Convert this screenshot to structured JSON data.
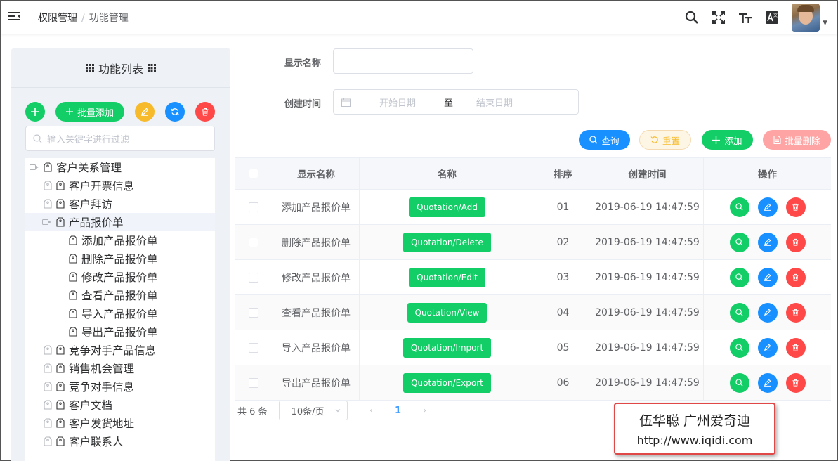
{
  "breadcrumb": {
    "parent": "权限管理",
    "separator": "/",
    "current": "功能管理"
  },
  "header_icons": [
    "search-icon",
    "fullscreen-icon",
    "font-size-icon",
    "translate-icon"
  ],
  "left_panel": {
    "title": "功能列表",
    "batch_add_label": "批量添加",
    "filter_placeholder": "输入关键字进行过滤",
    "tree": [
      {
        "label": "客户关系管理",
        "level": 0,
        "expanded": true
      },
      {
        "label": "客户开票信息",
        "level": 1
      },
      {
        "label": "客户拜访",
        "level": 1
      },
      {
        "label": "产品报价单",
        "level": 1,
        "expanded": true,
        "selected": true
      },
      {
        "label": "添加产品报价单",
        "level": 2
      },
      {
        "label": "删除产品报价单",
        "level": 2
      },
      {
        "label": "修改产品报价单",
        "level": 2
      },
      {
        "label": "查看产品报价单",
        "level": 2
      },
      {
        "label": "导入产品报价单",
        "level": 2
      },
      {
        "label": "导出产品报价单",
        "level": 2
      },
      {
        "label": "竞争对手产品信息",
        "level": 1
      },
      {
        "label": "销售机会管理",
        "level": 1
      },
      {
        "label": "竞争对手信息",
        "level": 1
      },
      {
        "label": "客户文档",
        "level": 1
      },
      {
        "label": "客户发货地址",
        "level": 1
      },
      {
        "label": "客户联系人",
        "level": 1
      }
    ]
  },
  "search_form": {
    "display_name_label": "显示名称",
    "display_name_value": "",
    "created_time_label": "创建时间",
    "start_placeholder": "开始日期",
    "range_separator": "至",
    "end_placeholder": "结束日期"
  },
  "actions": {
    "query": "查询",
    "reset": "重置",
    "add": "添加",
    "batch_delete": "批量删除"
  },
  "table": {
    "headers": {
      "display_name": "显示名称",
      "name": "名称",
      "sort": "排序",
      "created": "创建时间",
      "ops": "操作"
    },
    "rows": [
      {
        "display_name": "添加产品报价单",
        "name": "Quotation/Add",
        "sort": "01",
        "created": "2019-06-19 14:47:59"
      },
      {
        "display_name": "删除产品报价单",
        "name": "Quotation/Delete",
        "sort": "02",
        "created": "2019-06-19 14:47:59"
      },
      {
        "display_name": "修改产品报价单",
        "name": "Quotation/Edit",
        "sort": "03",
        "created": "2019-06-19 14:47:59"
      },
      {
        "display_name": "查看产品报价单",
        "name": "Quotation/View",
        "sort": "04",
        "created": "2019-06-19 14:47:59"
      },
      {
        "display_name": "导入产品报价单",
        "name": "Quotation/Import",
        "sort": "05",
        "created": "2019-06-19 14:47:59"
      },
      {
        "display_name": "导出产品报价单",
        "name": "Quotation/Export",
        "sort": "06",
        "created": "2019-06-19 14:47:59"
      }
    ]
  },
  "pagination": {
    "total": "共 6 条",
    "page_size": "10条/页",
    "prev": "‹",
    "current": "1",
    "next": "›"
  },
  "watermark": {
    "line1": "伍华聪 广州爱奇迪",
    "line2": "http://www.iqidi.com"
  },
  "colors": {
    "green": "#13ce66",
    "blue": "#1890ff",
    "yellow": "#f7ba2a",
    "red": "#ff4949",
    "primary": "#409eff"
  }
}
